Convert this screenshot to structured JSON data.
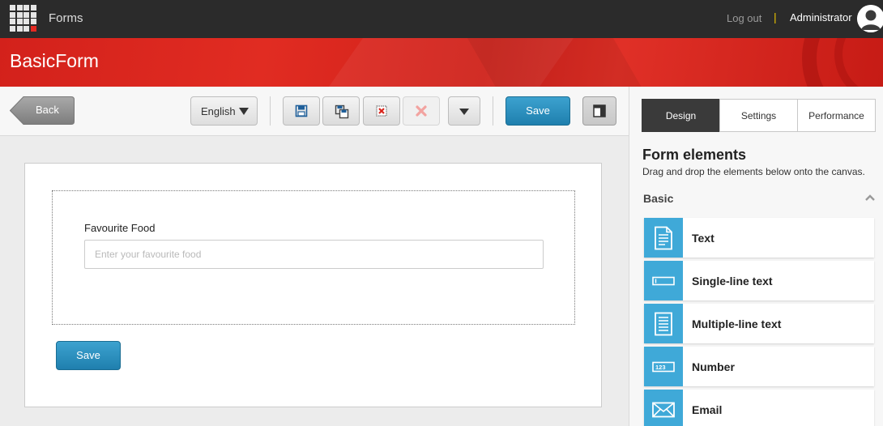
{
  "header": {
    "app_name": "Forms",
    "logout_label": "Log out",
    "separator": "|",
    "user_name": "Administrator"
  },
  "page": {
    "title": "BasicForm"
  },
  "toolbar": {
    "back_label": "Back",
    "language": "English",
    "save_label": "Save"
  },
  "form": {
    "field_label": "Favourite Food",
    "field_placeholder": "Enter your favourite food",
    "field_value": "",
    "submit_label": "Save"
  },
  "panel": {
    "tabs": [
      {
        "label": "Design",
        "active": true
      },
      {
        "label": "Settings",
        "active": false
      },
      {
        "label": "Performance",
        "active": false
      }
    ],
    "title": "Form elements",
    "description": "Drag and drop the elements below onto the canvas.",
    "section": "Basic",
    "elements": [
      {
        "label": "Text",
        "icon": "text-doc-icon"
      },
      {
        "label": "Single-line text",
        "icon": "single-line-icon"
      },
      {
        "label": "Multiple-line text",
        "icon": "multi-line-icon"
      },
      {
        "label": "Number",
        "icon": "number-icon"
      },
      {
        "label": "Email",
        "icon": "email-icon"
      }
    ]
  },
  "colors": {
    "topbar": "#2b2b2b",
    "brand_red": "#d9251c",
    "accent_blue": "#2a8fbd",
    "element_icon_bg": "#3fa9d8"
  }
}
